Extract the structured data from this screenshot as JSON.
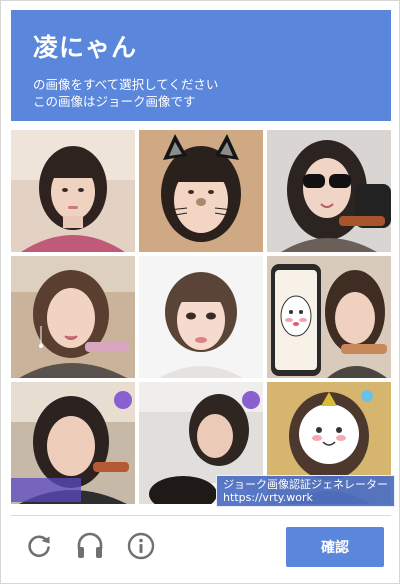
{
  "captcha": {
    "title": "凌にゃん",
    "instruction_line1": "の画像をすべて選択してください",
    "instruction_line2": "この画像はジョーク画像です"
  },
  "tiles": [
    {
      "index": 1,
      "description": "woman with bangs, light background"
    },
    {
      "index": 2,
      "description": "woman with cat-ear filter"
    },
    {
      "index": 3,
      "description": "woman with sunglasses and microphone"
    },
    {
      "index": 4,
      "description": "woman with earphones speaking"
    },
    {
      "index": 5,
      "description": "woman with short hair, face filter"
    },
    {
      "index": 6,
      "description": "woman holding phone with drawing"
    },
    {
      "index": 7,
      "description": "woman with earphones, live stream"
    },
    {
      "index": 8,
      "description": "person looking down at phone"
    },
    {
      "index": 9,
      "description": "person with cartoon face sticker"
    }
  ],
  "watermark": {
    "line1": "ジョーク画像認証ジェネレーター",
    "line2": "https://vrty.work"
  },
  "footer": {
    "confirm_label": "確認",
    "icons": [
      "refresh-icon",
      "headphones-icon",
      "info-icon"
    ]
  },
  "colors": {
    "accent": "#5a86db",
    "header_text": "#ffffff",
    "icon_gray": "#707070"
  }
}
